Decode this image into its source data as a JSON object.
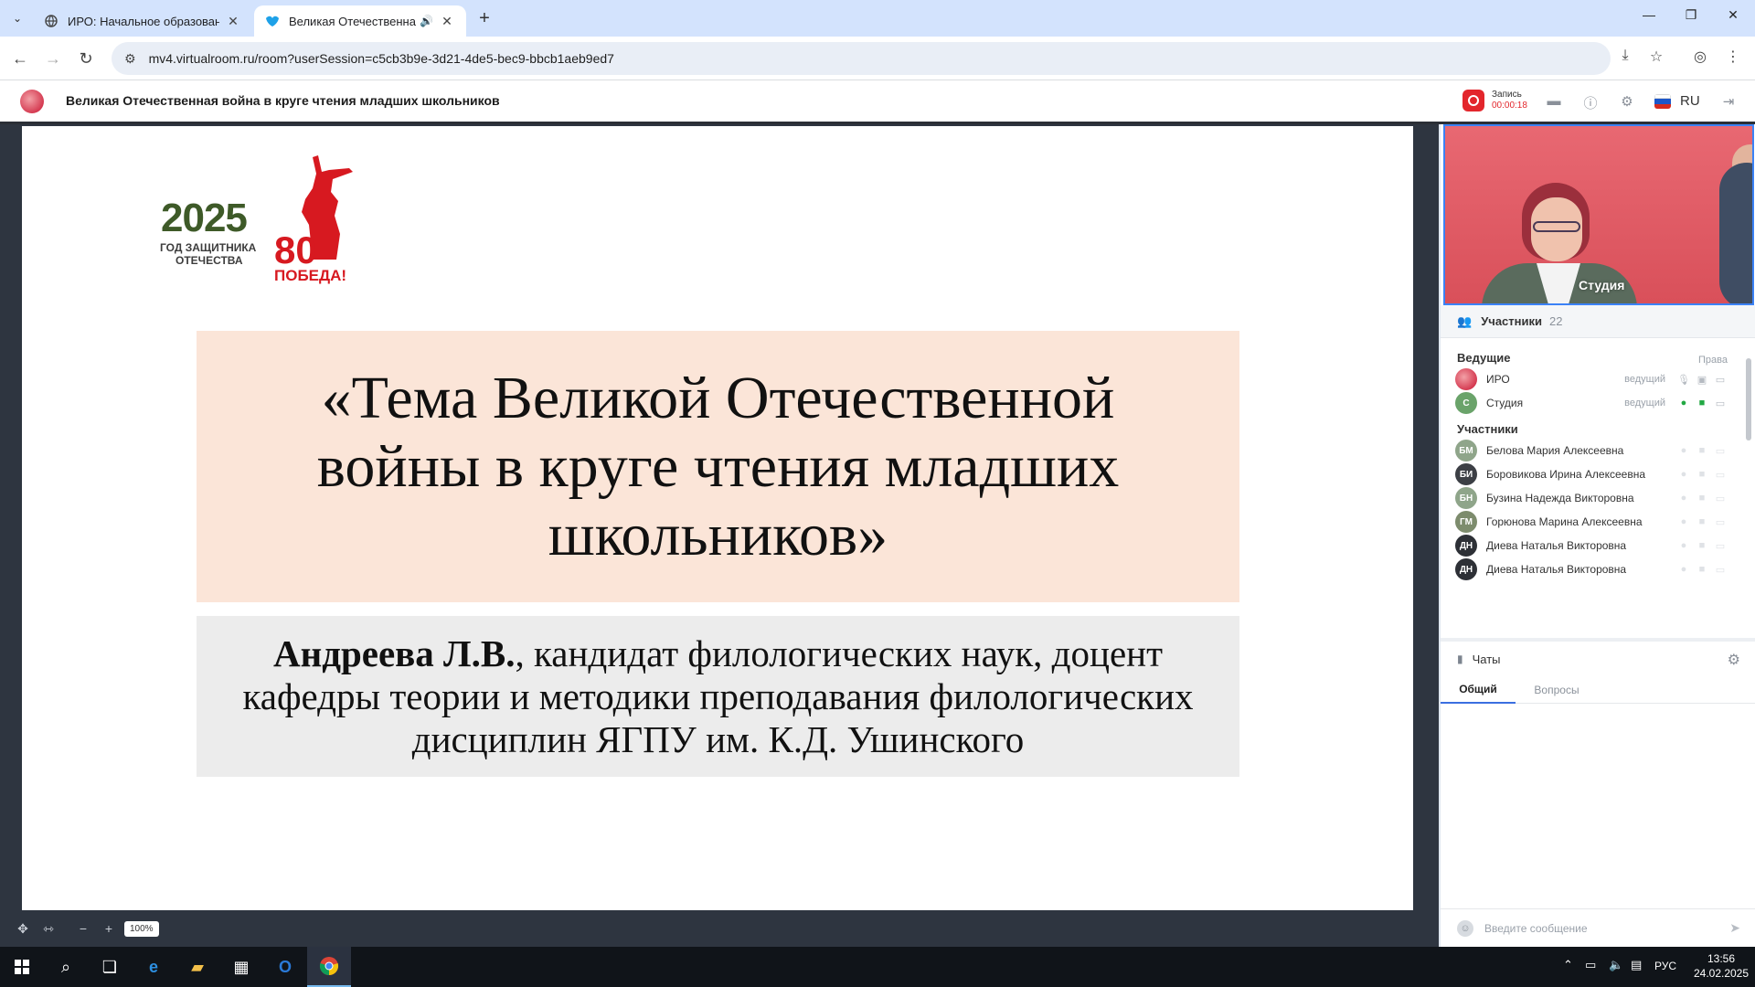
{
  "browser": {
    "tabs": [
      {
        "title": "ИРО: Начальное образование",
        "active": false
      },
      {
        "title": "Великая Отечественная во",
        "active": true
      }
    ],
    "url": "mv4.virtualroom.ru/room?userSession=c5cb3b9e-3d21-4de5-bec9-bbcb1aeb9ed7"
  },
  "app": {
    "title": "Великая Отечественная война в круге чтения младших школьников",
    "record_label": "Запись",
    "record_time": "00:00:18",
    "lang": "RU",
    "colors": {
      "accent": "#3b6fe0",
      "record": "#e3262c",
      "mic_on": "#22a843"
    }
  },
  "slide": {
    "logo_year": "2025",
    "logo_sub1": "ГОД ЗАЩИТНИКА",
    "logo_sub2": "ОТЕЧЕСТВА",
    "logo_80": "80",
    "logo_pobeda": "ПОБЕДА!",
    "title": "«Тема Великой Отечественной войны в круге чтения младших школьников»",
    "author_bold": "Андреева Л.В.",
    "author_rest": ", кандидат филологических наук, доцент кафедры теории и методики преподавания филологических дисциплин ЯГПУ им. К.Д. Ушинского"
  },
  "zoom": "100%",
  "video": {
    "label": "Студия"
  },
  "participants": {
    "header": "Участники",
    "count": "22",
    "hosts_label": "Ведущие",
    "rights_label": "Права",
    "hosts": [
      {
        "name": "ИРО",
        "role": "ведущий",
        "initials": ""
      },
      {
        "name": "Студия",
        "role": "ведущий",
        "initials": "С"
      }
    ],
    "members_label": "Участники",
    "members": [
      {
        "name": "Белова Мария Алексеевна",
        "initials": "БМ"
      },
      {
        "name": "Боровикова Ирина Алексеевна",
        "initials": "БИ"
      },
      {
        "name": "Бузина Надежда Викторовна",
        "initials": "БН"
      },
      {
        "name": "Горюнова Марина Алексеевна",
        "initials": "ГМ"
      },
      {
        "name": "Диева Наталья Викторовна",
        "initials": "ДН"
      },
      {
        "name": "Диева Наталья Викторовна",
        "initials": "ДН"
      }
    ]
  },
  "chats": {
    "header": "Чаты",
    "tabs": [
      "Общий",
      "Вопросы"
    ],
    "input_placeholder": "Введите сообщение"
  },
  "taskbar": {
    "lang": "РУС",
    "time": "13:56",
    "date": "24.02.2025"
  }
}
